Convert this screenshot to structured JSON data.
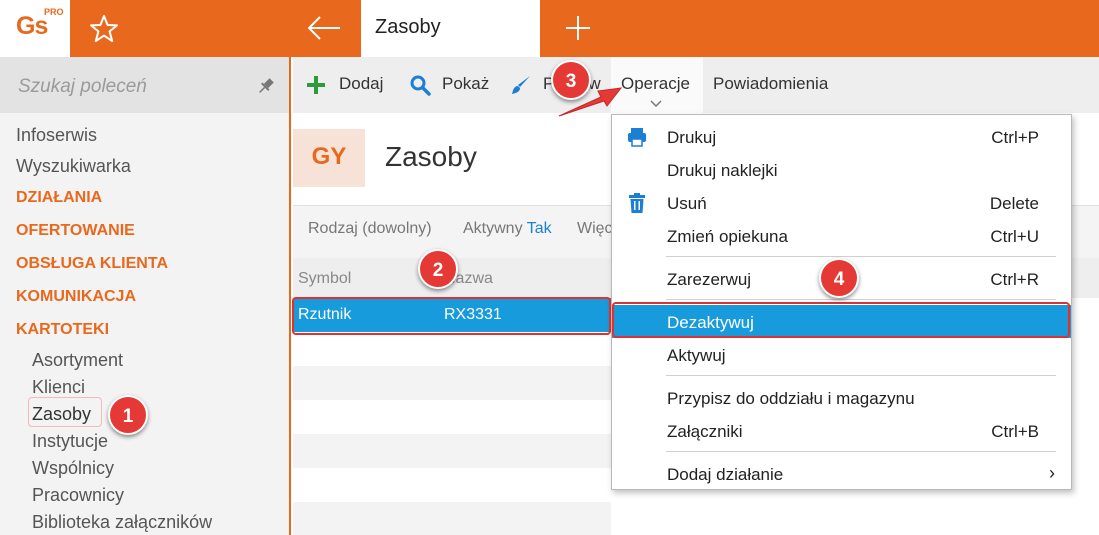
{
  "header": {
    "logo_text": "Gs",
    "logo_sup": "PRO",
    "tab_title": "Zasoby"
  },
  "sidebar": {
    "search_placeholder": "Szukaj poleceń",
    "items": [
      "Infoserwis",
      "Wyszukiwarka"
    ],
    "sections": [
      "DZIAŁANIA",
      "OFERTOWANIE",
      "OBSŁUGA KLIENTA",
      "KOMUNIKACJA",
      "KARTOTEKI"
    ],
    "subitems": [
      "Asortyment",
      "Klienci",
      "Zasoby",
      "Instytucje",
      "Wspólnicy",
      "Pracownicy",
      "Biblioteka załączników"
    ],
    "selected": "Zasoby"
  },
  "toolbar": {
    "add": "Dodaj",
    "show": "Pokaż",
    "edit": "Popraw",
    "operations": "Operacje",
    "notifications": "Powiadomienia"
  },
  "page": {
    "badge": "GY",
    "title": "Zasoby"
  },
  "filters": {
    "kind": "Rodzaj (dowolny)",
    "active_label": "Aktywny",
    "active_value": "Tak",
    "more": "Więcej"
  },
  "grid": {
    "columns": [
      "Symbol",
      "Nazwa"
    ],
    "rows": [
      {
        "symbol": "Rzutnik",
        "name": "RX3331"
      }
    ]
  },
  "menu": {
    "items": [
      {
        "label": "Drukuj",
        "shortcut": "Ctrl+P",
        "icon": "printer-icon"
      },
      {
        "label": "Drukuj naklejki",
        "shortcut": ""
      },
      {
        "label": "Usuń",
        "shortcut": "Delete",
        "icon": "trash-icon"
      },
      {
        "label": "Zmień opiekuna",
        "shortcut": "Ctrl+U"
      },
      {
        "label": "Zarezerwuj",
        "shortcut": "Ctrl+R"
      },
      {
        "label": "Dezaktywuj",
        "shortcut": ""
      },
      {
        "label": "Aktywuj",
        "shortcut": ""
      },
      {
        "label": "Przypisz do oddziału i magazynu",
        "shortcut": ""
      },
      {
        "label": "Załączniki",
        "shortcut": "Ctrl+B"
      },
      {
        "label": "Dodaj działanie",
        "shortcut": ""
      }
    ],
    "submenu_arrow": "›",
    "highlighted": "Dezaktywuj"
  },
  "annotations": [
    "1",
    "2",
    "3",
    "4"
  ],
  "colors": {
    "brand": "#e8691d",
    "selection": "#179bdc",
    "annotation": "#e53935"
  }
}
